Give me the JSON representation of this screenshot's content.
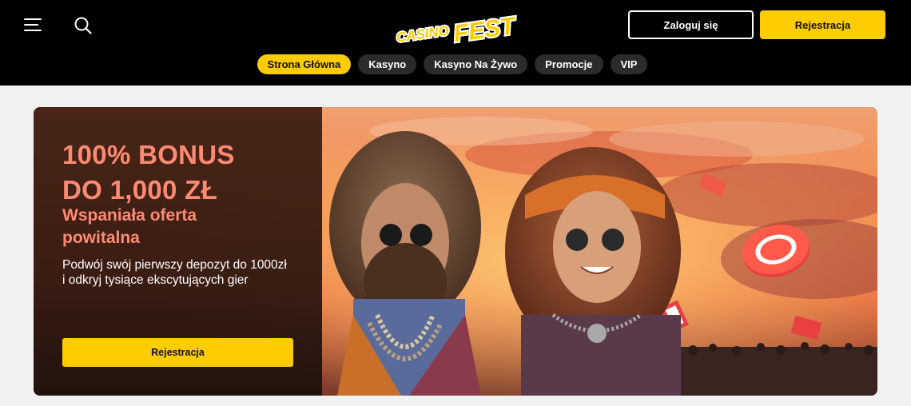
{
  "header": {
    "menu_icon": "hamburger-menu-icon",
    "search_icon": "search-icon",
    "logo": {
      "word1": "CASINO",
      "word2": "FEST"
    },
    "login_label": "Zaloguj się",
    "register_label": "Rejestracja"
  },
  "nav": {
    "items": [
      {
        "label": "Strona Główna",
        "active": true
      },
      {
        "label": "Kasyno",
        "active": false
      },
      {
        "label": "Kasyno Na Żywo",
        "active": false
      },
      {
        "label": "Promocje",
        "active": false
      },
      {
        "label": "VIP",
        "active": false
      }
    ]
  },
  "hero": {
    "title": "100% BONUS\nDO 1,000 ZŁ",
    "subtitle": "Wspaniała oferta\npowitalna",
    "description": "Podwój swój pierwszy depozyt do 1000zł i odkryj tysiące ekscytujących gier",
    "cta_label": "Rejestracja"
  },
  "colors": {
    "header_bg": "#000000",
    "accent_yellow": "#ffcc00",
    "hero_text_salmon": "#ff8a72",
    "page_bg": "#f2f2f2"
  }
}
